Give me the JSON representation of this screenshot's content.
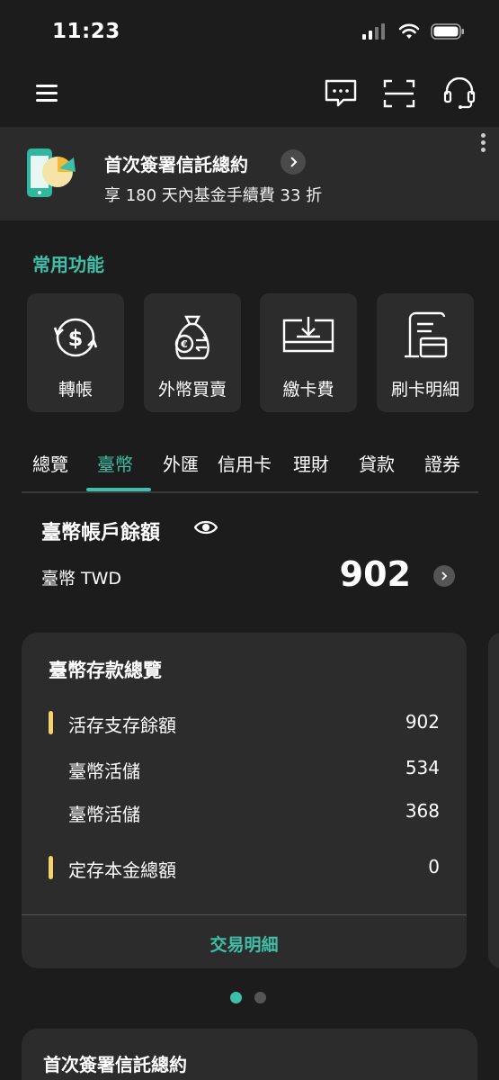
{
  "status": {
    "time": "11:23"
  },
  "promo": {
    "title": "首次簽署信託總約",
    "subtitle": "享 180 天內基金手續費 33 折"
  },
  "common": {
    "title": "常用功能",
    "items": [
      {
        "label": "轉帳",
        "icon": "transfer-dollar-icon"
      },
      {
        "label": "外幣買賣",
        "icon": "foreign-exchange-bag-icon"
      },
      {
        "label": "繳卡費",
        "icon": "card-payment-tray-icon"
      },
      {
        "label": "刷卡明細",
        "icon": "card-statement-icon"
      }
    ]
  },
  "tabs": [
    "總覽",
    "臺幣",
    "外匯",
    "信用卡",
    "理財",
    "貸款",
    "證券"
  ],
  "active_tab": "臺幣",
  "balance": {
    "title": "臺幣帳戶餘額",
    "currency": "臺幣 TWD",
    "amount": "902"
  },
  "deposit_card": {
    "title": "臺幣存款總覽",
    "rows": [
      {
        "label": "活存支存餘額",
        "value": "902"
      },
      {
        "label": "臺幣活儲",
        "value": "534"
      },
      {
        "label": "臺幣活儲",
        "value": "368"
      },
      {
        "label": "定存本金總額",
        "value": "0"
      }
    ],
    "link": "交易明細"
  },
  "card2": {
    "title": "首次簽署信託總約"
  },
  "colors": {
    "accent": "#3fbfa8",
    "highlight_bar": "#f5d36b",
    "background": "#1c1c1c",
    "card": "#2c2c2c"
  }
}
